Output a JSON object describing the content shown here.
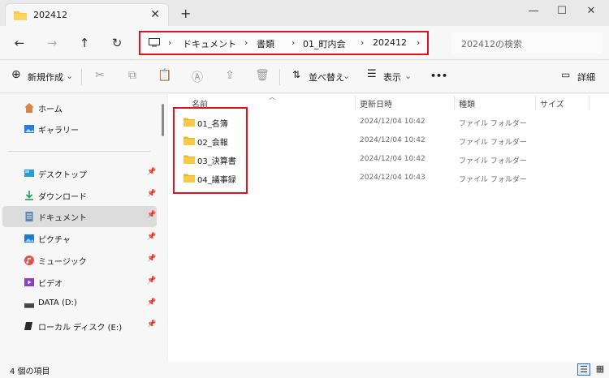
{
  "tab": {
    "title": "202412",
    "close": "✕",
    "new": "+"
  },
  "window": {
    "minimize": "—",
    "maximize": "☐",
    "close": "✕"
  },
  "nav": {
    "back": "←",
    "forward": "→",
    "up": "↑",
    "refresh": "↻"
  },
  "breadcrumb": {
    "sep": "›",
    "items": [
      "ドキュメント",
      "書類",
      "01_町内会",
      "202412"
    ]
  },
  "search": {
    "placeholder": "202412の検索"
  },
  "toolbar": {
    "new_label": "新規作成",
    "sort_label": "並べ替え",
    "view_label": "表示",
    "more": "•••",
    "details_label": "詳細",
    "dropdown": "⌄"
  },
  "sidebar": {
    "items": [
      {
        "label": "ホーム",
        "icon": "home-icon"
      },
      {
        "label": "ギャラリー",
        "icon": "gallery-icon"
      },
      {
        "label": "デスクトップ",
        "icon": "desktop-icon",
        "pin": true
      },
      {
        "label": "ダウンロード",
        "icon": "download-icon",
        "pin": true
      },
      {
        "label": "ドキュメント",
        "icon": "documents-icon",
        "pin": true,
        "selected": true
      },
      {
        "label": "ピクチャ",
        "icon": "pictures-icon",
        "pin": true
      },
      {
        "label": "ミュージック",
        "icon": "music-icon",
        "pin": true
      },
      {
        "label": "ビデオ",
        "icon": "video-icon",
        "pin": true
      },
      {
        "label": "DATA (D:)",
        "icon": "drive-icon",
        "pin": true
      },
      {
        "label": "ローカル ディスク (E:)",
        "icon": "drive-icon",
        "pin": true
      }
    ],
    "pin_glyph": "📌"
  },
  "columns": {
    "name": "名前",
    "date": "更新日時",
    "type": "種類",
    "size": "サイズ"
  },
  "files": [
    {
      "name": "01_名簿",
      "date": "2024/12/04 10:42",
      "type": "ファイル フォルダー"
    },
    {
      "name": "02_会報",
      "date": "2024/12/04 10:42",
      "type": "ファイル フォルダー"
    },
    {
      "name": "03_決算書",
      "date": "2024/12/04 10:42",
      "type": "ファイル フォルダー"
    },
    {
      "name": "04_議事録",
      "date": "2024/12/04 10:43",
      "type": "ファイル フォルダー"
    }
  ],
  "status": {
    "count": "4 個の項目"
  },
  "colors": {
    "accent": "#e0141e",
    "folder": "#f7c948"
  }
}
